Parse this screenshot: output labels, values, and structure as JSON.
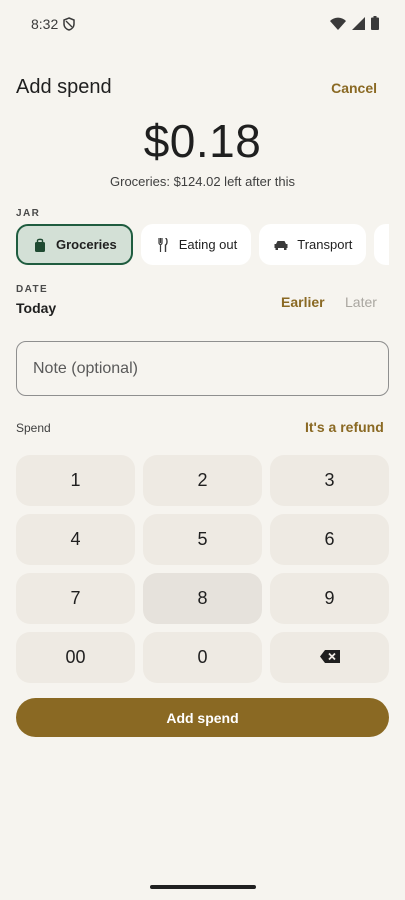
{
  "status": {
    "time": "8:32"
  },
  "header": {
    "title": "Add spend",
    "cancel_label": "Cancel"
  },
  "amount": {
    "value": "$0.18",
    "remaining_text": "Groceries: $124.02 left after this"
  },
  "jar": {
    "label": "JAR",
    "items": [
      {
        "label": "Groceries",
        "icon": "shopping-bag-icon",
        "selected": true
      },
      {
        "label": "Eating out",
        "icon": "cutlery-icon",
        "selected": false
      },
      {
        "label": "Transport",
        "icon": "car-icon",
        "selected": false
      },
      {
        "label": "",
        "icon": "ticket-icon",
        "selected": false
      }
    ]
  },
  "date": {
    "label": "DATE",
    "value": "Today",
    "earlier_label": "Earlier",
    "later_label": "Later"
  },
  "note": {
    "placeholder": "Note (optional)",
    "value": ""
  },
  "spend": {
    "label": "Spend",
    "refund_label": "It's a refund"
  },
  "keypad": {
    "keys": [
      "1",
      "2",
      "3",
      "4",
      "5",
      "6",
      "7",
      "8",
      "9",
      "00",
      "0",
      "backspace"
    ]
  },
  "submit": {
    "label": "Add spend"
  },
  "colors": {
    "accent": "#8a6923",
    "selected_chip_bg": "#d3e0d6",
    "selected_chip_border": "#1f5c3f",
    "background": "#f6f4ef"
  }
}
